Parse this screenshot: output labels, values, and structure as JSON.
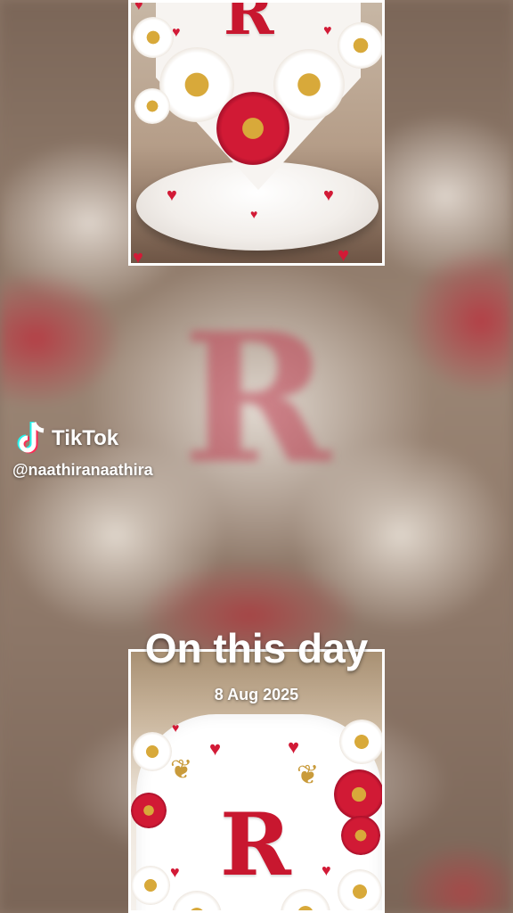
{
  "watermark": {
    "app_name": "TikTok",
    "username": "@naathiranaathira",
    "icon": "tiktok-logo-icon"
  },
  "memory": {
    "title": "On this day",
    "date": "8 Aug 2025"
  },
  "image": {
    "letter": "R"
  },
  "colors": {
    "accent_red": "#c8172f",
    "text": "#ffffff",
    "tiktok_cyan": "#25f4ee",
    "tiktok_pink": "#fe2c55"
  }
}
